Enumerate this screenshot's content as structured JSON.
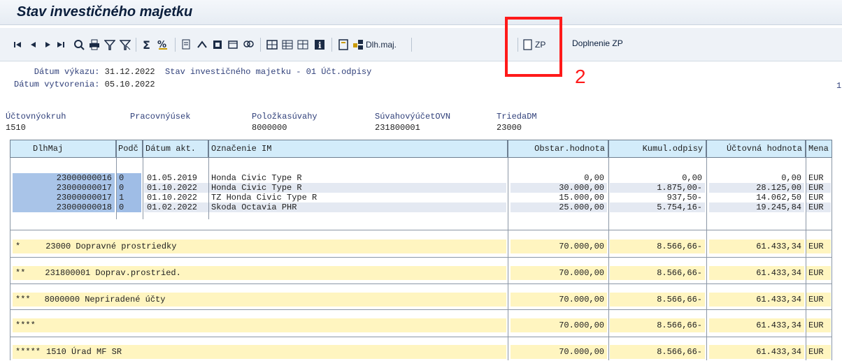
{
  "window": {
    "title": "Stav investičného majetku"
  },
  "toolbar": {
    "buttons": [
      {
        "name": "first-page-icon"
      },
      {
        "name": "previous-page-icon"
      },
      {
        "name": "next-page-icon"
      },
      {
        "name": "last-page-icon"
      },
      {
        "name": "details-icon"
      },
      {
        "name": "print-icon"
      },
      {
        "name": "filter-icon"
      },
      {
        "name": "delete-filter-icon"
      },
      {
        "name": "sum-icon"
      },
      {
        "name": "subtotal-icon"
      },
      {
        "name": "export-icon"
      },
      {
        "name": "graphic-icon"
      },
      {
        "name": "word-icon"
      },
      {
        "name": "layout-icon"
      },
      {
        "name": "find-icon"
      },
      {
        "name": "grid-icon"
      },
      {
        "name": "choose-layout-icon"
      },
      {
        "name": "save-layout-icon"
      },
      {
        "name": "info-icon"
      },
      {
        "name": "document-icon"
      }
    ],
    "dlh_maj_label": "Dlh.maj.",
    "zp_label": "ZP",
    "doplnenie_label": "Doplnenie ZP"
  },
  "report": {
    "datum_vykazu_label": "    Dátum výkazu:",
    "datum_vykazu": "31.12.2022",
    "report_name": "Stav investičného majetku - 01 Účt.odpisy",
    "datum_vytvorenia_label": "Dátum vytvorenia:",
    "datum_vytvorenia": "05.10.2022",
    "page": "1"
  },
  "dimensions": {
    "labels": [
      "Účtovnýokruh",
      "Pracovnýúsek",
      "Položkasúvahy",
      "SúvahovýúčetOVN",
      "TriedaDM"
    ],
    "values": [
      "1510",
      "",
      "8000000",
      "231800001",
      "23000"
    ]
  },
  "table": {
    "columns": [
      "DlhMaj",
      "Podč",
      "Dátum akt.",
      "Označenie IM",
      "Obstar.hodnota",
      "Kumul.odpisy",
      "Účtovná hodnota",
      "Mena"
    ],
    "rows": [
      {
        "dlhmaj": "23000000016",
        "podc": "0",
        "datum": "01.05.2019",
        "oznacenie": "Honda Civic Type R",
        "obstar": "0,00",
        "kumul": "0,00",
        "uctovna": "0,00",
        "mena": "EUR"
      },
      {
        "dlhmaj": "23000000017",
        "podc": "0",
        "datum": "01.10.2022",
        "oznacenie": "Honda Civic Type R",
        "obstar": "30.000,00",
        "kumul": "1.875,00-",
        "uctovna": "28.125,00",
        "mena": "EUR"
      },
      {
        "dlhmaj": "23000000017",
        "podc": "1",
        "datum": "01.10.2022",
        "oznacenie": "TZ Honda Civic Type R",
        "obstar": "15.000,00",
        "kumul": "937,50-",
        "uctovna": "14.062,50",
        "mena": "EUR"
      },
      {
        "dlhmaj": "23000000018",
        "podc": "0",
        "datum": "01.02.2022",
        "oznacenie": "Skoda Octavia PHR",
        "obstar": "25.000,00",
        "kumul": "5.754,16-",
        "uctovna": "19.245,84",
        "mena": "EUR"
      }
    ],
    "totals": [
      {
        "level": "*",
        "text": "23000 Dopravné prostriedky",
        "obstar": "70.000,00",
        "kumul": "8.566,66-",
        "uctovna": "61.433,34",
        "mena": "EUR"
      },
      {
        "level": "**",
        "text": "231800001 Doprav.prostried.",
        "obstar": "70.000,00",
        "kumul": "8.566,66-",
        "uctovna": "61.433,34",
        "mena": "EUR"
      },
      {
        "level": "***",
        "text": "8000000 Nepriradené účty",
        "obstar": "70.000,00",
        "kumul": "8.566,66-",
        "uctovna": "61.433,34",
        "mena": "EUR"
      },
      {
        "level": "****",
        "text": "",
        "obstar": "70.000,00",
        "kumul": "8.566,66-",
        "uctovna": "61.433,34",
        "mena": "EUR"
      },
      {
        "level": "*****",
        "text": "1510 Úrad MF SR",
        "obstar": "70.000,00",
        "kumul": "8.566,66-",
        "uctovna": "61.433,34",
        "mena": "EUR"
      }
    ]
  },
  "annotation": {
    "number": "2",
    "color": "#ff1a1a"
  }
}
